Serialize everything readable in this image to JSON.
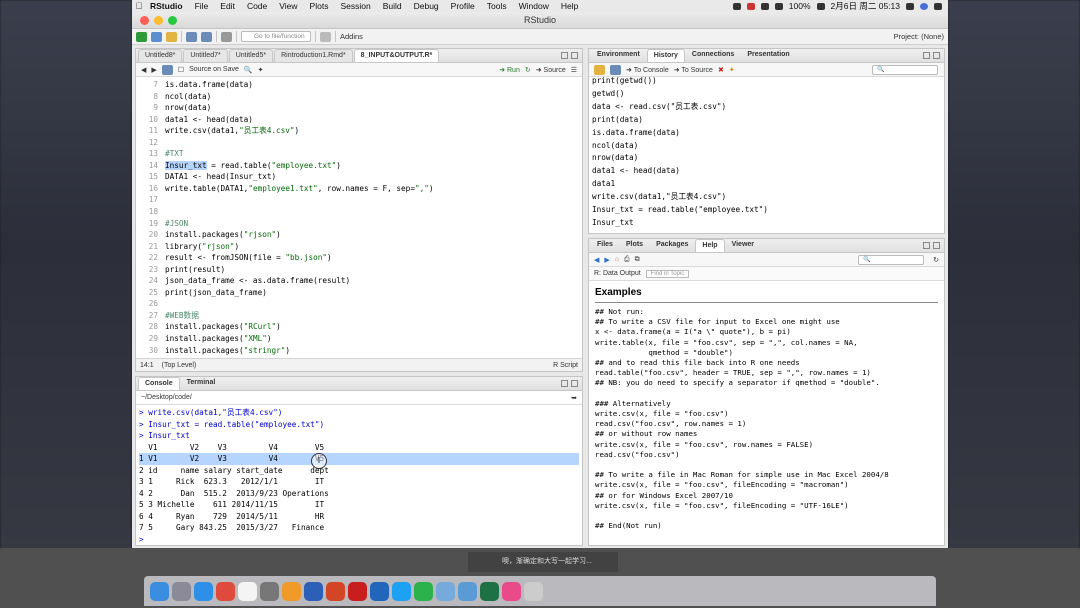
{
  "menubar": {
    "app_name": "RStudio",
    "items": [
      "File",
      "Edit",
      "Code",
      "View",
      "Plots",
      "Session",
      "Build",
      "Debug",
      "Profile",
      "Tools",
      "Window",
      "Help"
    ],
    "battery": "100%",
    "datetime": "2月6日 周二  05:13"
  },
  "window": {
    "title": "RStudio"
  },
  "toolbar": {
    "goto_placeholder": "Go to file/function",
    "addins": "Addins",
    "project": "Project: (None)"
  },
  "editor": {
    "tabs": [
      "Untitled8*",
      "Untitled7*",
      "Untitled5*",
      "Rintroduction1.Rmd*",
      "8_INPUT&OUTPUT.R*"
    ],
    "source_on_save": "Source on Save",
    "run": "Run",
    "source": "Source",
    "line_numbers": [
      "7",
      "8",
      "9",
      "10",
      "11",
      "12",
      "13",
      "14",
      "15",
      "16",
      "17",
      "18",
      "19",
      "20",
      "21",
      "22",
      "23",
      "24",
      "25",
      "26",
      "27",
      "28",
      "29",
      "30"
    ],
    "lines": [
      "is.data.frame(data)",
      "ncol(data)",
      "nrow(data)",
      "data1 <- head(data)",
      "write.csv(data1,\"员工表4.csv\")",
      "",
      "#TXT",
      "Insur_txt = read.table(\"employee.txt\")",
      "DATA1 <- head(Insur_txt)",
      "write.table(DATA1,\"employee1.txt\", row.names = F, sep=\",\")",
      "",
      "",
      "#JSON",
      "install.packages(\"rjson\")",
      "library(\"rjson\")",
      "result <- fromJSON(file = \"bb.json\")",
      "print(result)",
      "json_data_frame <- as.data.frame(result)",
      "print(json_data_frame)",
      "",
      "#WEB数据",
      "install.packages(\"RCurl\")",
      "install.packages(\"XML\")",
      "install.packages(\"stringr\")"
    ],
    "status_pos": "14:1",
    "status_scope": "(Top Level)",
    "status_type": "R Script"
  },
  "console": {
    "tabs": [
      "Console",
      "Terminal"
    ],
    "path": "~/Desktop/code/",
    "lines": [
      "> write.csv(data1,\"员工表4.csv\")",
      "> Insur_txt = read.table(\"employee.txt\")",
      "> Insur_txt",
      "  V1       V2    V3         V4        V5",
      "1 V1       V2    V3         V4        V5",
      "2 id     name salary start_date      dept",
      "3 1     Rick  623.3   2012/1/1        IT",
      "4 2      Dan  515.2  2013/9/23 Operations",
      "5 3 Michelle    611 2014/11/15        IT",
      "6 4     Ryan    729  2014/5/11        HR",
      "7 5     Gary 843.25  2015/3/27   Finance",
      ">"
    ]
  },
  "environment": {
    "tabs": [
      "Environment",
      "History",
      "Connections",
      "Presentation"
    ],
    "to_console": "To Console",
    "to_source": "To Source",
    "lines": [
      "print(getwd())",
      "getwd()",
      "data <- read.csv(\"员工表.csv\")",
      "print(data)",
      "is.data.frame(data)",
      "ncol(data)",
      "nrow(data)",
      "data1 <- head(data)",
      "data1",
      "write.csv(data1,\"员工表4.csv\")",
      "Insur_txt = read.table(\"employee.txt\")",
      "Insur_txt"
    ]
  },
  "help": {
    "tabs": [
      "Files",
      "Plots",
      "Packages",
      "Help",
      "Viewer"
    ],
    "topic": "R: Data Output",
    "find_placeholder": "Find in Topic",
    "heading": "Examples",
    "lines": [
      "## Not run:",
      "## To write a CSV file for input to Excel one might use",
      "x <- data.frame(a = I(\"a \\\" quote\"), b = pi)",
      "write.table(x, file = \"foo.csv\", sep = \",\", col.names = NA,",
      "            qmethod = \"double\")",
      "## and to read this file back into R one needs",
      "read.table(\"foo.csv\", header = TRUE, sep = \",\", row.names = 1)",
      "## NB: you do need to specify a separator if qmethod = \"double\".",
      "",
      "### Alternatively",
      "write.csv(x, file = \"foo.csv\")",
      "read.csv(\"foo.csv\", row.names = 1)",
      "## or without row names",
      "write.csv(x, file = \"foo.csv\", row.names = FALSE)",
      "read.csv(\"foo.csv\")",
      "",
      "## To write a file in Mac Roman for simple use in Mac Excel 2004/8",
      "write.csv(x, file = \"foo.csv\", fileEncoding = \"macroman\")",
      "## or for Windows Excel 2007/10",
      "write.csv(x, file = \"foo.csv\", fileEncoding = \"UTF-16LE\")",
      "",
      "## End(Not run)"
    ]
  },
  "notification": "噢，渐确定和大写一起学习...",
  "colors": {
    "accent": "#1f6fd1",
    "selection": "#b5d5ff",
    "string": "#036a07",
    "comment": "#4c886b"
  },
  "dock_icons": [
    "finder",
    "launchpad",
    "safari",
    "chrome",
    "calendar",
    "preferences",
    "photos",
    "word",
    "powerpoint",
    "acrobat",
    "r",
    "qq",
    "wechat",
    "rstudio",
    "preview",
    "excel",
    "itunes",
    "trash"
  ]
}
